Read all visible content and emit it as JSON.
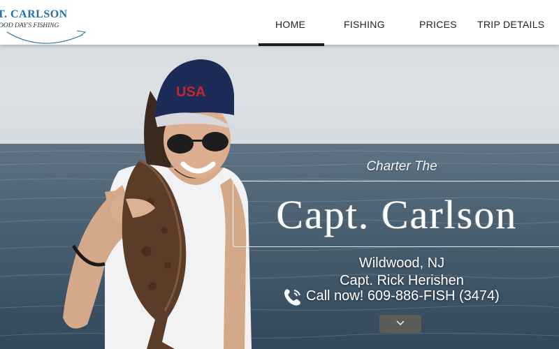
{
  "logo": {
    "title": "T. CARLSON",
    "subtitle": "OOD DAY'S FISHING"
  },
  "nav": {
    "items": [
      {
        "label": "HOME",
        "active": true
      },
      {
        "label": "FISHING",
        "active": false
      },
      {
        "label": "PRICES",
        "active": false
      },
      {
        "label": "TRIP DETAILS",
        "active": false
      }
    ]
  },
  "hero": {
    "tagline": "Charter The",
    "title": "Capt. Carlson",
    "location": "Wildwood, NJ",
    "captain": "Capt. Rick Herishen",
    "call": "Call now! 609-886-FISH (3474)",
    "scroll_icon": "chevron-down-icon"
  },
  "colors": {
    "brand_blue": "#1f6fb0",
    "nav_active_underline": "#1b1b1b",
    "header_bg": "#ffffff"
  }
}
